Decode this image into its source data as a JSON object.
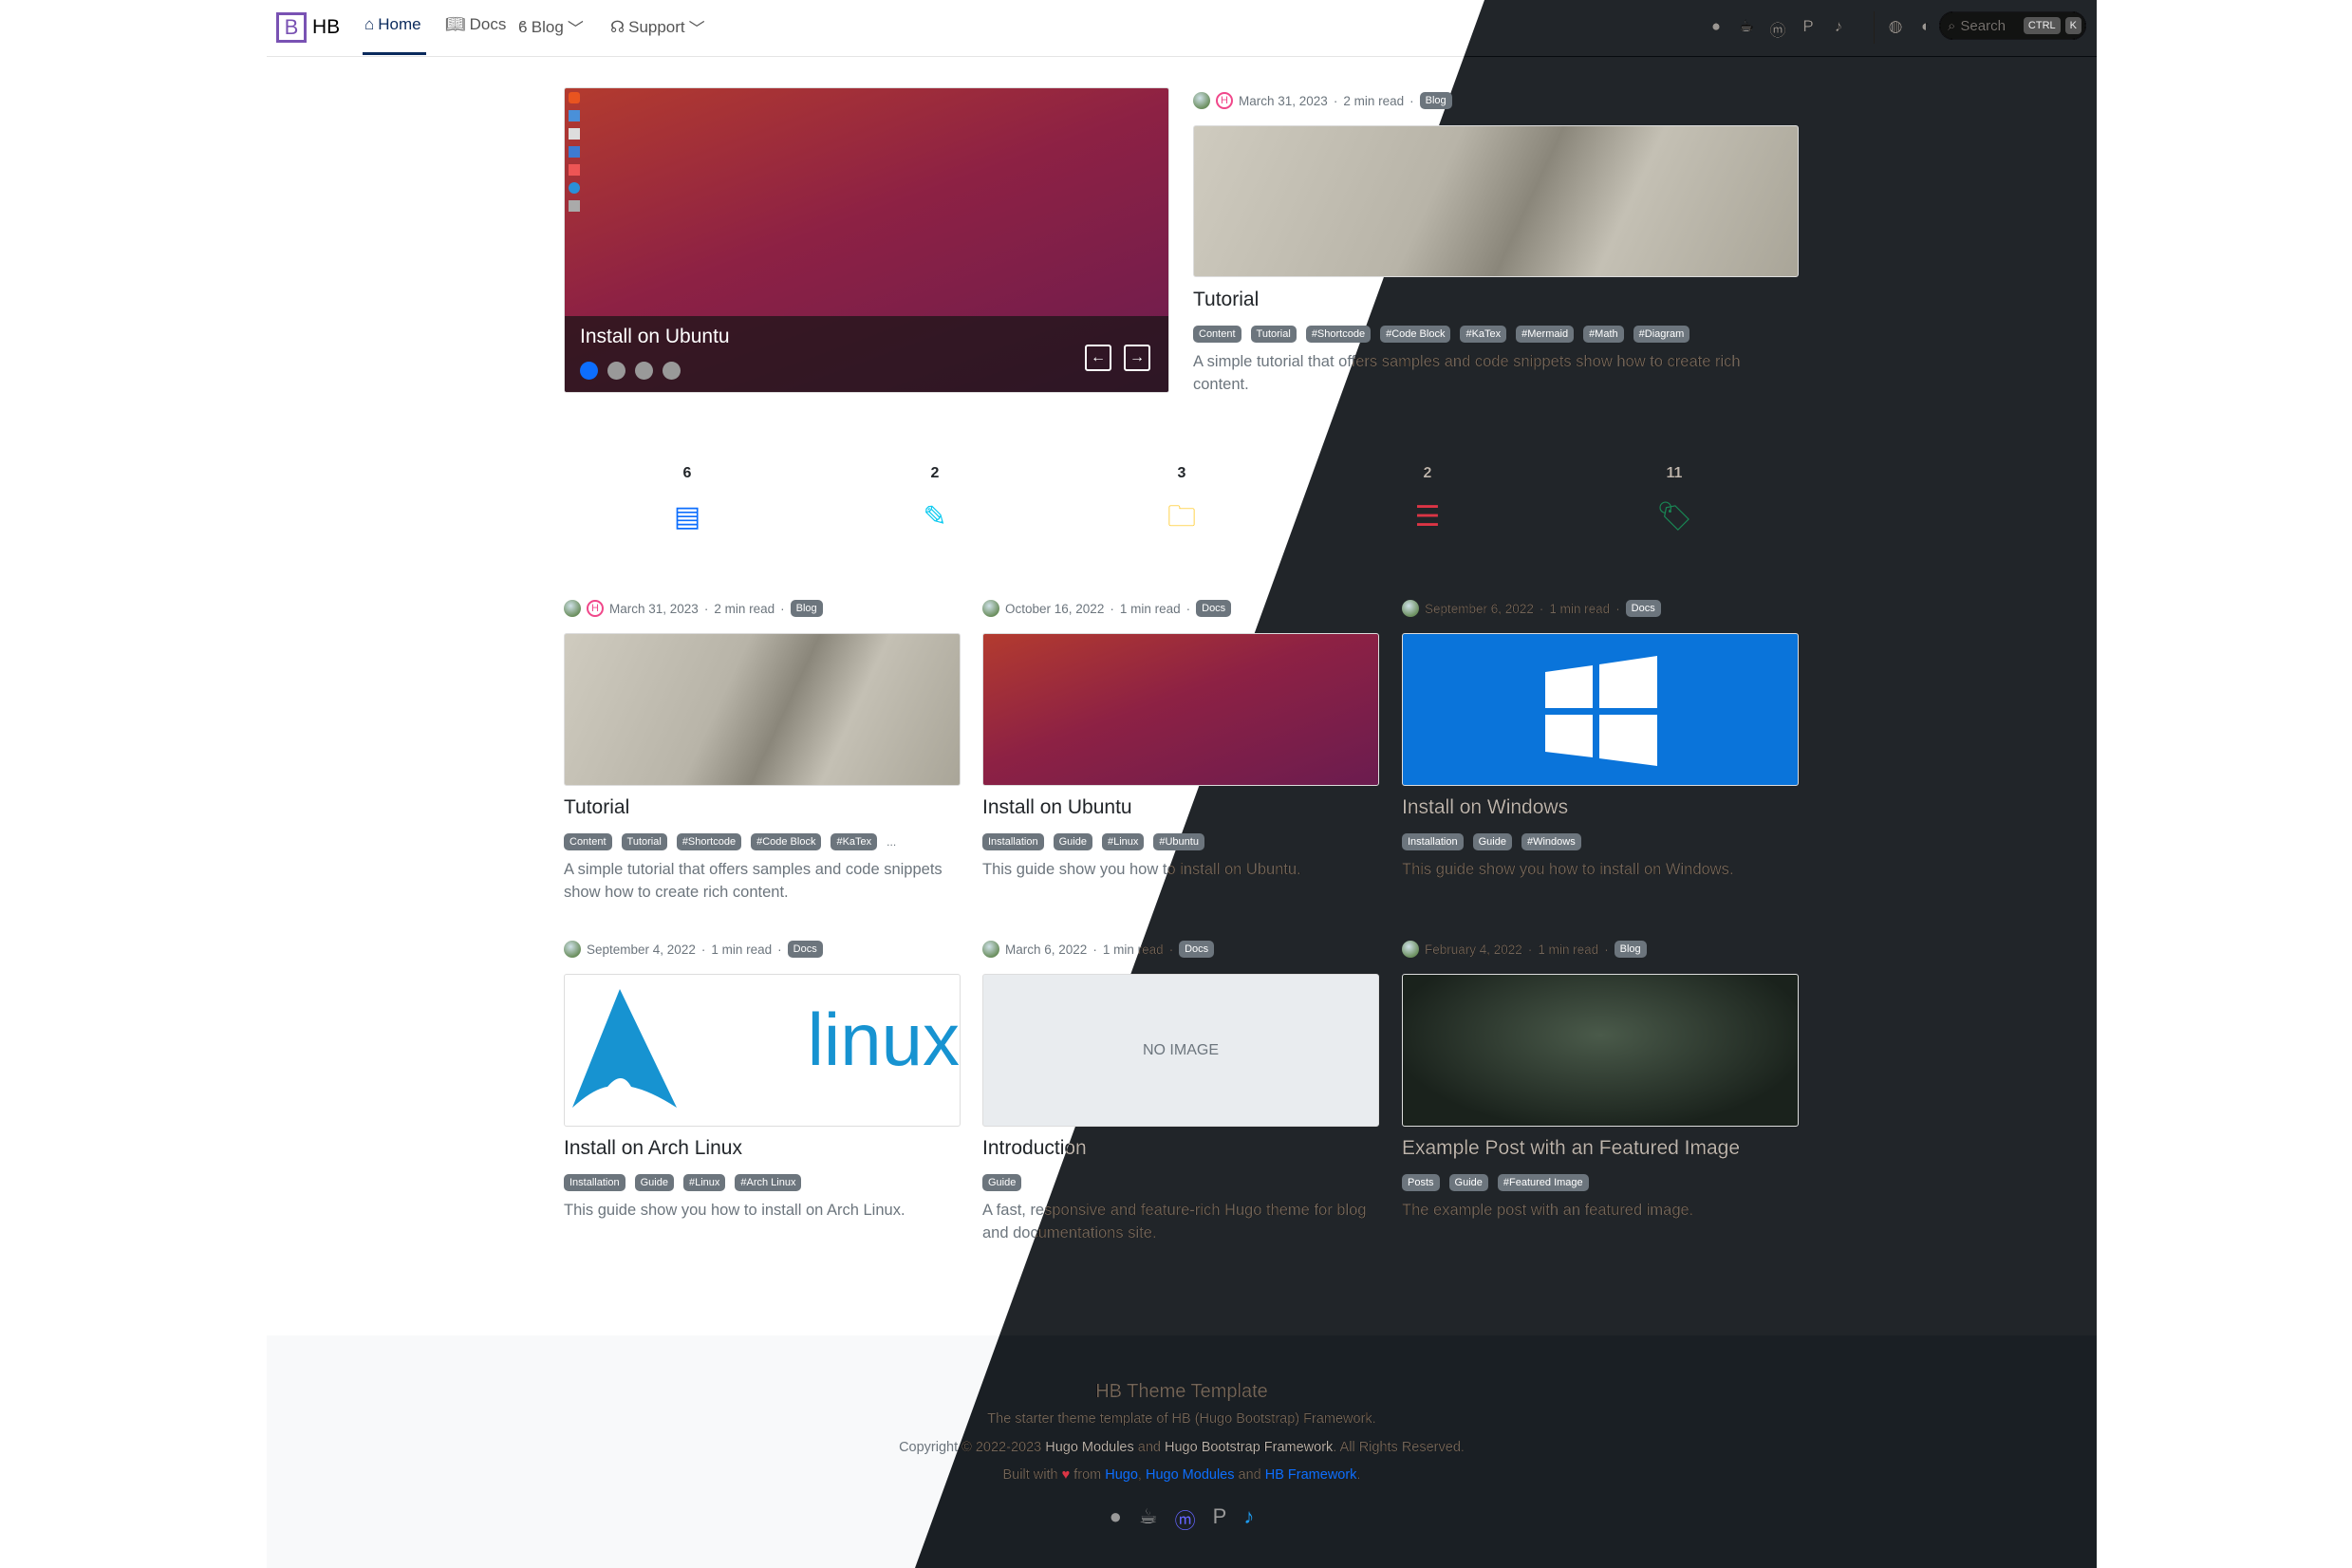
{
  "navbar": {
    "brand": "HB",
    "brand_logo": "B",
    "items": [
      {
        "label": "Home",
        "icon": "home-icon"
      },
      {
        "label": "Docs",
        "icon": "book-icon"
      },
      {
        "label": "Blog",
        "icon": "blog-icon"
      },
      {
        "label": "Support",
        "icon": "headset-icon"
      }
    ],
    "social": [
      "github-icon",
      "kofi-icon",
      "mastodon-icon",
      "paypal-icon",
      "twitter-icon"
    ],
    "language_icon": "globe-icon",
    "theme_icon": "contrast-icon",
    "search": {
      "placeholder": "Search",
      "kbd1": "CTRL",
      "kbd2": "K"
    }
  },
  "carousel": {
    "title": "Install on Ubuntu",
    "slides": 4,
    "active": 1
  },
  "featured": {
    "date": "March 31, 2023",
    "read": "2 min read",
    "section": "Blog",
    "title": "Tutorial",
    "tags": [
      "Content",
      "Tutorial",
      "#Shortcode",
      "#Code Block",
      "#KaTex",
      "#Mermaid",
      "#Math",
      "#Diagram"
    ],
    "desc": "A simple tutorial that offers samples and code snippets show how to create rich content."
  },
  "stats": [
    {
      "count": "6",
      "icon": "post-icon",
      "color": "#0d6efd"
    },
    {
      "count": "2",
      "icon": "edit-icon",
      "color": "#0dcaf0"
    },
    {
      "count": "3",
      "icon": "folder-icon",
      "color": "#ffc107"
    },
    {
      "count": "2",
      "icon": "list-icon",
      "color": "#dc3545"
    },
    {
      "count": "11",
      "icon": "tag-icon",
      "color": "#198754"
    }
  ],
  "posts": [
    {
      "date": "March 31, 2023",
      "read": "2 min read",
      "section": "Blog",
      "pin": true,
      "image": "pen",
      "title": "Tutorial",
      "tags": [
        "Content",
        "Tutorial",
        "#Shortcode",
        "#Code Block",
        "#KaTex"
      ],
      "more": "...",
      "desc": "A simple tutorial that offers samples and code snippets show how to create rich content."
    },
    {
      "date": "October 16, 2022",
      "read": "1 min read",
      "section": "Docs",
      "image": "ubuntu",
      "title": "Install on Ubuntu",
      "tags": [
        "Installation",
        "Guide",
        "#Linux",
        "#Ubuntu"
      ],
      "desc": "This guide show you how to install on Ubuntu."
    },
    {
      "date": "September 6, 2022",
      "read": "1 min read",
      "section": "Docs",
      "image": "win",
      "title": "Install on Windows",
      "tags": [
        "Installation",
        "Guide",
        "#Windows"
      ],
      "desc": "This guide show you how to install on Windows."
    },
    {
      "date": "September 4, 2022",
      "read": "1 min read",
      "section": "Docs",
      "image": "arch",
      "logo_text": "linux",
      "title": "Install on Arch Linux",
      "tags": [
        "Installation",
        "Guide",
        "#Linux",
        "#Arch Linux"
      ],
      "desc": "This guide show you how to install on Arch Linux."
    },
    {
      "date": "March 6, 2022",
      "read": "1 min read",
      "section": "Docs",
      "image": "noimg",
      "image_text": "NO IMAGE",
      "title": "Introduction",
      "tags": [
        "Guide"
      ],
      "desc": "A fast, responsive and feature-rich Hugo theme for blog and documentations site."
    },
    {
      "date": "February 4, 2022",
      "read": "1 min read",
      "section": "Blog",
      "image": "forest",
      "title": "Example Post with an Featured Image",
      "tags": [
        "Posts",
        "Guide",
        "#Featured Image"
      ],
      "desc": "The example post with an featured image."
    }
  ],
  "footer": {
    "title": "HB Theme Template",
    "tagline": "The starter theme template of HB (Hugo Bootstrap) Framework.",
    "copyright_prefix": "Copyright © 2022-2023",
    "link1": "Hugo Modules",
    "and": "and",
    "link2": "Hugo Bootstrap Framework",
    "copyright_suffix": ". All Rights Reserved.",
    "built_prefix": "Built with",
    "built_from": "from",
    "b1": "Hugo",
    "b2": "Hugo Modules",
    "b3": "HB Framework",
    "end": ".",
    "icons": [
      "github-icon",
      "kofi-icon",
      "mastodon-icon",
      "paypal-icon",
      "twitter-icon"
    ]
  }
}
